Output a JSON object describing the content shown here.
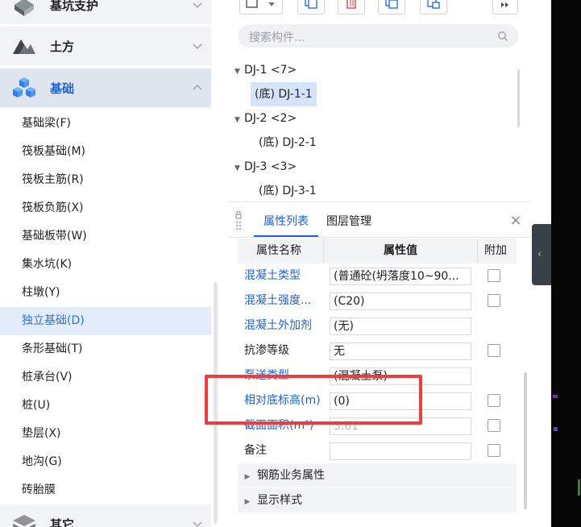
{
  "sidebar": {
    "categories": [
      {
        "label": "基坑支护",
        "expanded": false
      },
      {
        "label": "土方",
        "expanded": false
      },
      {
        "label": "基础",
        "expanded": true
      },
      {
        "label": "其它",
        "expanded": false
      }
    ],
    "items": [
      {
        "label": "基础梁(F)"
      },
      {
        "label": "筏板基础(M)"
      },
      {
        "label": "筏板主筋(R)"
      },
      {
        "label": "筏板负筋(X)"
      },
      {
        "label": "基础板带(W)"
      },
      {
        "label": "集水坑(K)"
      },
      {
        "label": "柱墩(Y)"
      },
      {
        "label": "独立基础(D)",
        "selected": true
      },
      {
        "label": "条形基础(T)"
      },
      {
        "label": "桩承台(V)"
      },
      {
        "label": "桩(U)"
      },
      {
        "label": "垫层(X)"
      },
      {
        "label": "地沟(G)"
      },
      {
        "label": "砖胎膜"
      }
    ]
  },
  "search": {
    "placeholder": "搜索构件..."
  },
  "tree": [
    {
      "group": "DJ-1 <7>",
      "leaf": "(底) DJ-1-1",
      "selected": true
    },
    {
      "group": "DJ-2 <2>",
      "leaf": "(底) DJ-2-1",
      "selected": false
    },
    {
      "group": "DJ-3 <3>",
      "leaf": "(底) DJ-3-1",
      "selected": false
    }
  ],
  "tabs": {
    "properties": "属性列表",
    "layers": "图层管理"
  },
  "table": {
    "headers": {
      "name": "属性名称",
      "value": "属性值",
      "extra": "附加"
    },
    "rows": [
      {
        "name": "混凝土类型",
        "value": "(普通砼(坍落度10~90...",
        "checkbox": true,
        "style": "blue"
      },
      {
        "name": "混凝土强度...",
        "value": "(C20)",
        "checkbox": true,
        "style": "blue"
      },
      {
        "name": "混凝土外加剂",
        "value": "(无)",
        "checkbox": false,
        "style": "blue"
      },
      {
        "name": "抗渗等级",
        "value": "无",
        "checkbox": true,
        "style": "black"
      },
      {
        "name": "泵送类型",
        "value": "(混凝土泵)",
        "checkbox": false,
        "style": "blue"
      },
      {
        "name": "相对底标高(m)",
        "value": "(0)",
        "checkbox": true,
        "style": "blue"
      },
      {
        "name": "截面面积(m²)",
        "value": "3.61",
        "checkbox": true,
        "style": "blue",
        "disabled": true
      },
      {
        "name": "备注",
        "value": "",
        "checkbox": true,
        "style": "black"
      }
    ],
    "sections": [
      "钢筋业务属性",
      "显示样式"
    ]
  },
  "colors": {
    "accent": "#1e63d6",
    "selected_bg": "#e3edfc",
    "highlight": "#ee3d3d"
  }
}
